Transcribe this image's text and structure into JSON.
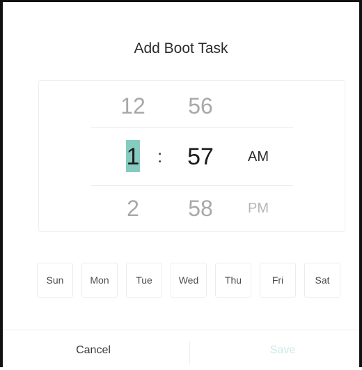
{
  "dialog": {
    "title": "Add Boot Task"
  },
  "picker": {
    "hours": {
      "prev": "12",
      "current": "1",
      "next": "2"
    },
    "minutes": {
      "prev": "56",
      "current": "57",
      "next": "58"
    },
    "separator": ":",
    "period": {
      "current": "AM",
      "next": "PM"
    }
  },
  "days": [
    "Sun",
    "Mon",
    "Tue",
    "Wed",
    "Thu",
    "Fri",
    "Sat"
  ],
  "footer": {
    "cancel_label": "Cancel",
    "save_label": "Save"
  },
  "colors": {
    "accent": "#86cbc0",
    "save_disabled": "#c7ece6"
  }
}
